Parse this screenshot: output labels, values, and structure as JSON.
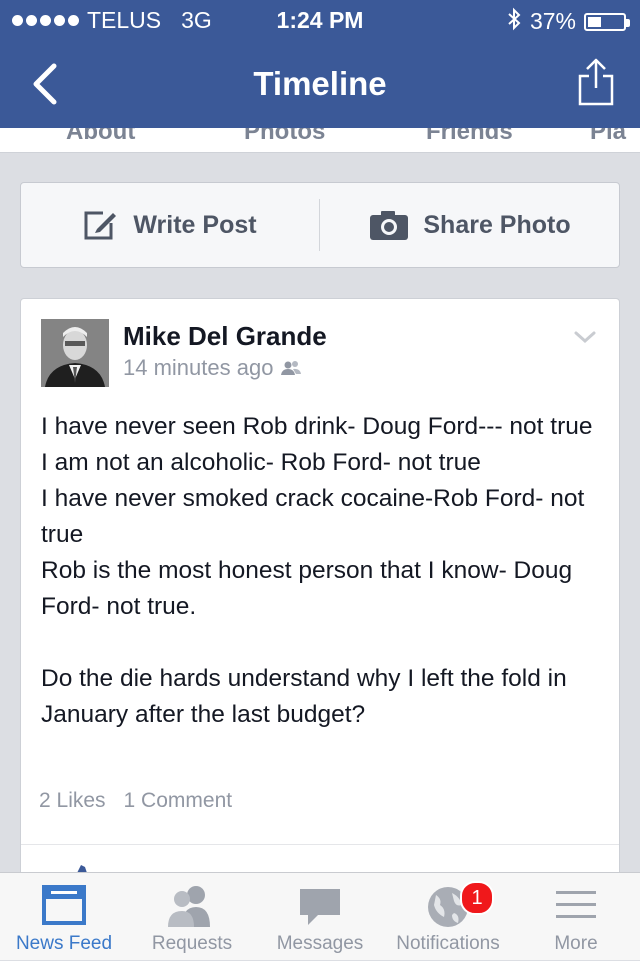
{
  "status_bar": {
    "carrier": "TELUS",
    "network": "3G",
    "time": "1:24 PM",
    "battery": "37%",
    "battery_level": 0.37
  },
  "nav": {
    "title": "Timeline",
    "back_icon": "chevron-left-icon",
    "share_icon": "share-icon"
  },
  "profile_tabs": [
    "About",
    "Photos",
    "Friends",
    "Pla"
  ],
  "composer": {
    "write_label": "Write Post",
    "share_label": "Share Photo"
  },
  "post": {
    "author": "Mike Del Grande",
    "time": "14 minutes ago",
    "text": "I have never seen Rob drink- Doug Ford--- not true\nI am not an alcoholic- Rob Ford- not true\nI have never smoked crack cocaine-Rob Ford- not true\nRob is the most honest person that I know- Doug Ford- not true.\n\nDo the die hards understand why I left the fold in January after the last budget?",
    "likes": "2 Likes",
    "comments": "1 Comment"
  },
  "tabbar": {
    "items": [
      {
        "label": "News Feed",
        "icon": "news-feed-icon",
        "active": true
      },
      {
        "label": "Requests",
        "icon": "requests-icon"
      },
      {
        "label": "Messages",
        "icon": "messages-icon"
      },
      {
        "label": "Notifications",
        "icon": "globe-icon",
        "badge": "1"
      },
      {
        "label": "More",
        "icon": "menu-icon"
      }
    ]
  },
  "colors": {
    "brand": "#3b5998",
    "active_tab": "#3b79c9",
    "badge": "#f0181b"
  }
}
